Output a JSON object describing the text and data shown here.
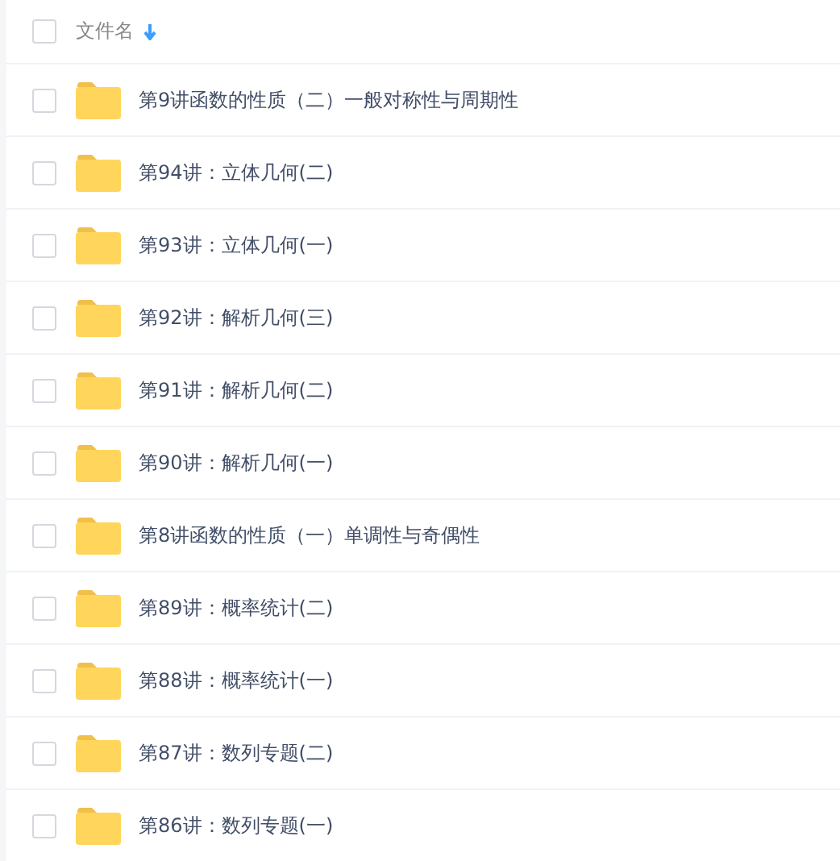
{
  "header": {
    "label": "文件名",
    "checked": false
  },
  "files": [
    {
      "name": "第9讲函数的性质（二）一般对称性与周期性",
      "checked": false
    },
    {
      "name": "第94讲：立体几何(二)",
      "checked": false
    },
    {
      "name": "第93讲：立体几何(一)",
      "checked": false
    },
    {
      "name": "第92讲：解析几何(三)",
      "checked": false
    },
    {
      "name": "第91讲：解析几何(二)",
      "checked": false
    },
    {
      "name": "第90讲：解析几何(一)",
      "checked": false
    },
    {
      "name": "第8讲函数的性质（一）单调性与奇偶性",
      "checked": false
    },
    {
      "name": "第89讲：概率统计(二)",
      "checked": false
    },
    {
      "name": "第88讲：概率统计(一)",
      "checked": false
    },
    {
      "name": "第87讲：数列专题(二)",
      "checked": false
    },
    {
      "name": "第86讲：数列专题(一)",
      "checked": false
    }
  ]
}
